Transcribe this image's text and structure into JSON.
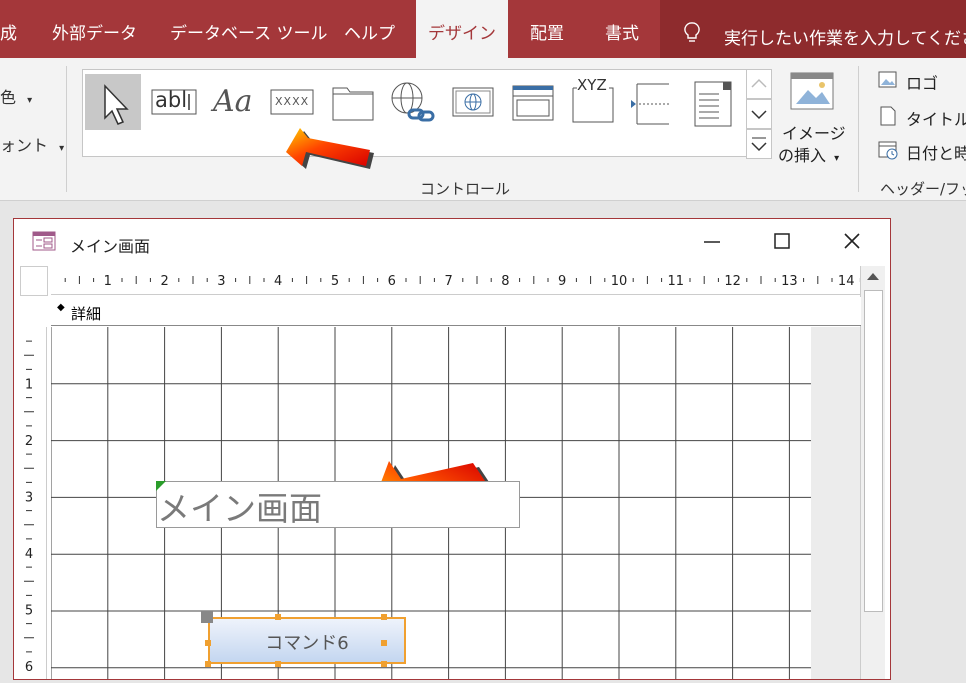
{
  "ribbon_tabs": [
    {
      "label": "成"
    },
    {
      "label": "外部データ"
    },
    {
      "label": "データベース ツール"
    },
    {
      "label": "ヘルプ"
    },
    {
      "label": "デザイン",
      "active": true
    },
    {
      "label": "配置"
    },
    {
      "label": "書式"
    }
  ],
  "tell_me": "実行したい作業を入力してください",
  "left_group": {
    "item1": "色",
    "item2": "ォント"
  },
  "controls_gallery": {
    "group_label": "コントロール",
    "items": [
      {
        "icon": "select-pointer-icon",
        "selected": true
      },
      {
        "icon": "textbox-icon",
        "text": "abl"
      },
      {
        "icon": "label-icon",
        "text": "Aa"
      },
      {
        "icon": "button-icon",
        "text": "XXXX"
      },
      {
        "icon": "tab-control-icon"
      },
      {
        "icon": "hyperlink-icon"
      },
      {
        "icon": "web-browser-icon"
      },
      {
        "icon": "navigation-control-icon"
      },
      {
        "icon": "option-group-icon",
        "text": "XYZ"
      },
      {
        "icon": "page-break-icon"
      },
      {
        "icon": "combo-box-icon"
      }
    ]
  },
  "insert_image": {
    "line1": "イメージ",
    "line2": "の挿入"
  },
  "header_footer": {
    "items": [
      {
        "icon": "logo-icon",
        "label": "ロゴ"
      },
      {
        "icon": "title-icon",
        "label": "タイトル"
      },
      {
        "icon": "date-time-icon",
        "label": "日付と時"
      }
    ],
    "group_label": "ヘッダー/フッ"
  },
  "form_window": {
    "title": "メイン画面",
    "section": "詳細",
    "ruler_h": [
      "1",
      "2",
      "3",
      "4",
      "5",
      "6",
      "7",
      "8",
      "9",
      "10",
      "11",
      "12",
      "13",
      "14"
    ],
    "ruler_v": [
      "1",
      "2",
      "3",
      "4",
      "5",
      "6"
    ],
    "label_text": "メイン画面",
    "command_button": "コマンド6"
  },
  "colors": {
    "tab_bar": "#a4373a",
    "tell_me_bg": "#8e2b2d",
    "button_border": "#f0a030"
  }
}
